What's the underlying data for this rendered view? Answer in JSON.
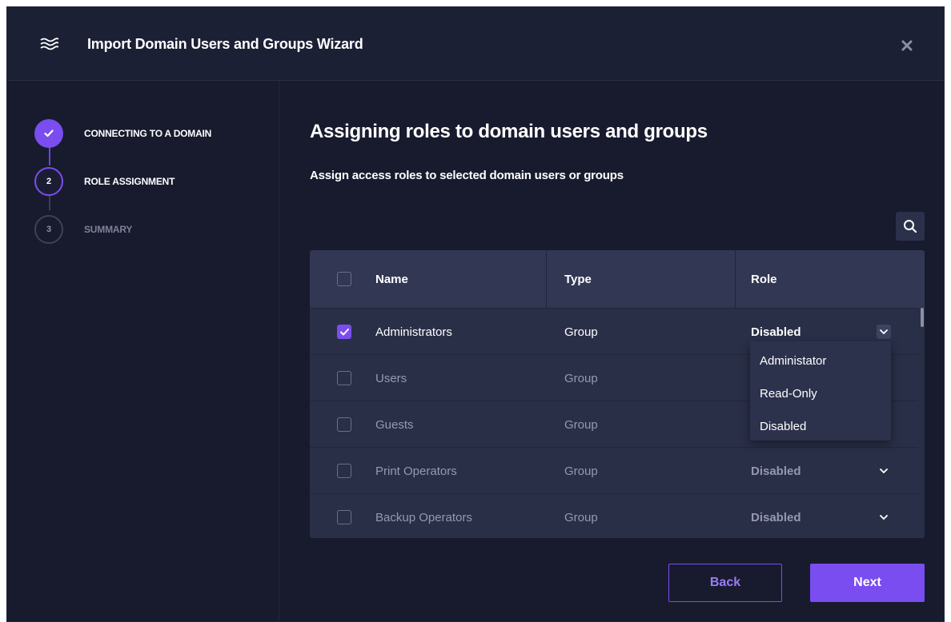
{
  "window": {
    "title": "Import Domain Users and Groups Wizard",
    "app_icon": "waves-icon",
    "close_icon": "close-icon"
  },
  "steps": [
    {
      "number": "",
      "label": "CONNECTING TO A DOMAIN",
      "state": "completed",
      "icon": "check-icon"
    },
    {
      "number": "2",
      "label": "ROLE ASSIGNMENT",
      "state": "active"
    },
    {
      "number": "3",
      "label": "SUMMARY",
      "state": "pending"
    }
  ],
  "main": {
    "heading": "Assigning roles to domain users and groups",
    "subheading": "Assign access roles to selected domain users or groups",
    "search_icon": "search-icon"
  },
  "table": {
    "columns": [
      "Name",
      "Type",
      "Role"
    ],
    "header_checkbox_checked": false,
    "rows": [
      {
        "name": "Administrators",
        "type": "Group",
        "role": "Disabled",
        "checked": true,
        "dropdown_open": true
      },
      {
        "name": "Users",
        "type": "Group",
        "role": "",
        "checked": false
      },
      {
        "name": "Guests",
        "type": "Group",
        "role": "",
        "checked": false
      },
      {
        "name": "Print Operators",
        "type": "Group",
        "role": "Disabled",
        "checked": false
      },
      {
        "name": "Backup Operators",
        "type": "Group",
        "role": "Disabled",
        "checked": false
      }
    ]
  },
  "role_dropdown": {
    "options": [
      "Administator",
      "Read-Only",
      "Disabled"
    ]
  },
  "footer": {
    "back_label": "Back",
    "next_label": "Next"
  },
  "colors": {
    "accent": "#7a4df0",
    "background": "#181b2e",
    "table": "#2a2f48"
  }
}
